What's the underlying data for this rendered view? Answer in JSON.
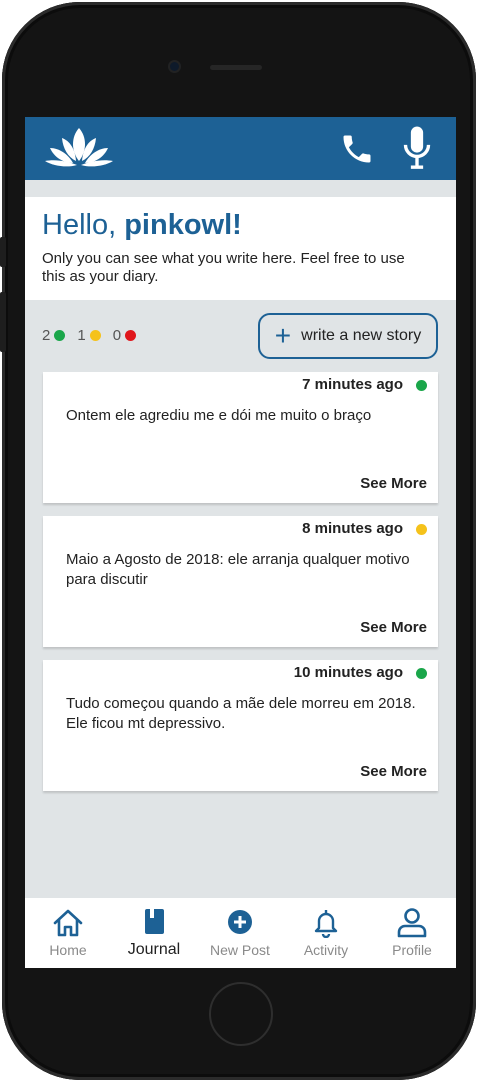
{
  "header": {
    "logo_icon": "lotus-icon",
    "actions": [
      {
        "icon": "phone-icon"
      },
      {
        "icon": "microphone-icon"
      }
    ],
    "color": "#1d6195"
  },
  "greeting": {
    "hello": "Hello,",
    "username": "pinkowl!",
    "subtitle": "Only you can see what you write here. Feel free to use this as your diary."
  },
  "status_counts": [
    {
      "count": "2",
      "color": "#1aa64a",
      "status": "green"
    },
    {
      "count": "1",
      "color": "#f5c21b",
      "status": "yellow"
    },
    {
      "count": "0",
      "color": "#e0161c",
      "status": "red"
    }
  ],
  "new_story": {
    "label": "write a new story",
    "icon": "plus-icon"
  },
  "stories": [
    {
      "time": "7 minutes ago",
      "status_color": "#1aa64a",
      "text": "Ontem ele agrediu me e dói me muito o braço",
      "see_more": "See More"
    },
    {
      "time": "8 minutes ago",
      "status_color": "#f5c21b",
      "text": "Maio a Agosto de 2018: ele arranja qualquer motivo para discutir",
      "see_more": "See More"
    },
    {
      "time": "10 minutes ago",
      "status_color": "#1aa64a",
      "text": "Tudo começou quando a mãe dele morreu em 2018. Ele ficou mt depressivo.",
      "see_more": "See More"
    }
  ],
  "tabs": [
    {
      "label": "Home",
      "icon": "home-icon",
      "active": false
    },
    {
      "label": "Journal",
      "icon": "journal-icon",
      "active": true
    },
    {
      "label": "New Post",
      "icon": "plus-circle-icon",
      "active": false
    },
    {
      "label": "Activity",
      "icon": "bell-icon",
      "active": false
    },
    {
      "label": "Profile",
      "icon": "user-icon",
      "active": false
    }
  ]
}
